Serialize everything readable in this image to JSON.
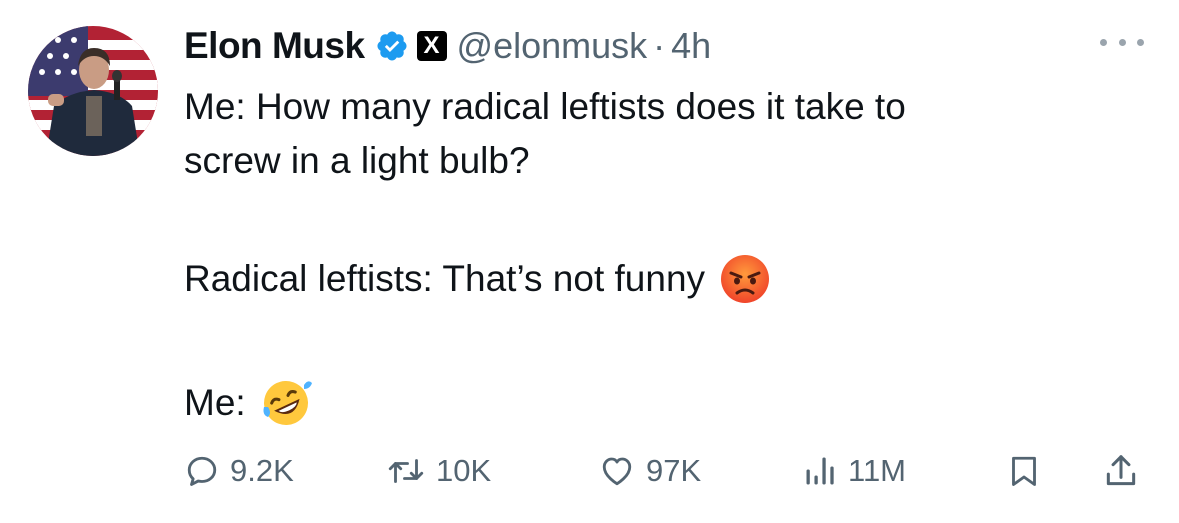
{
  "author": {
    "name": "Elon Musk",
    "handle": "@elonmusk",
    "separator": "·",
    "time": "4h",
    "verified_icon": "verified-badge-icon",
    "affiliation_icon": "x-logo-icon",
    "affiliation_label": "X"
  },
  "tweet": {
    "line1": "Me: How many radical leftists does it take to",
    "line2": "screw in a light bulb?",
    "line3": "Radical leftists: That’s not funny",
    "line3_emoji": "angry-face-emoji",
    "line4": "Me:",
    "line4_emoji": "rolling-on-floor-laughing-emoji"
  },
  "actions": {
    "replies": "9.2K",
    "reposts": "10K",
    "likes": "97K",
    "views": "11M"
  },
  "colors": {
    "accent": "#1d9bf0",
    "secondary_text": "#536471",
    "primary_text": "#0f1419"
  }
}
